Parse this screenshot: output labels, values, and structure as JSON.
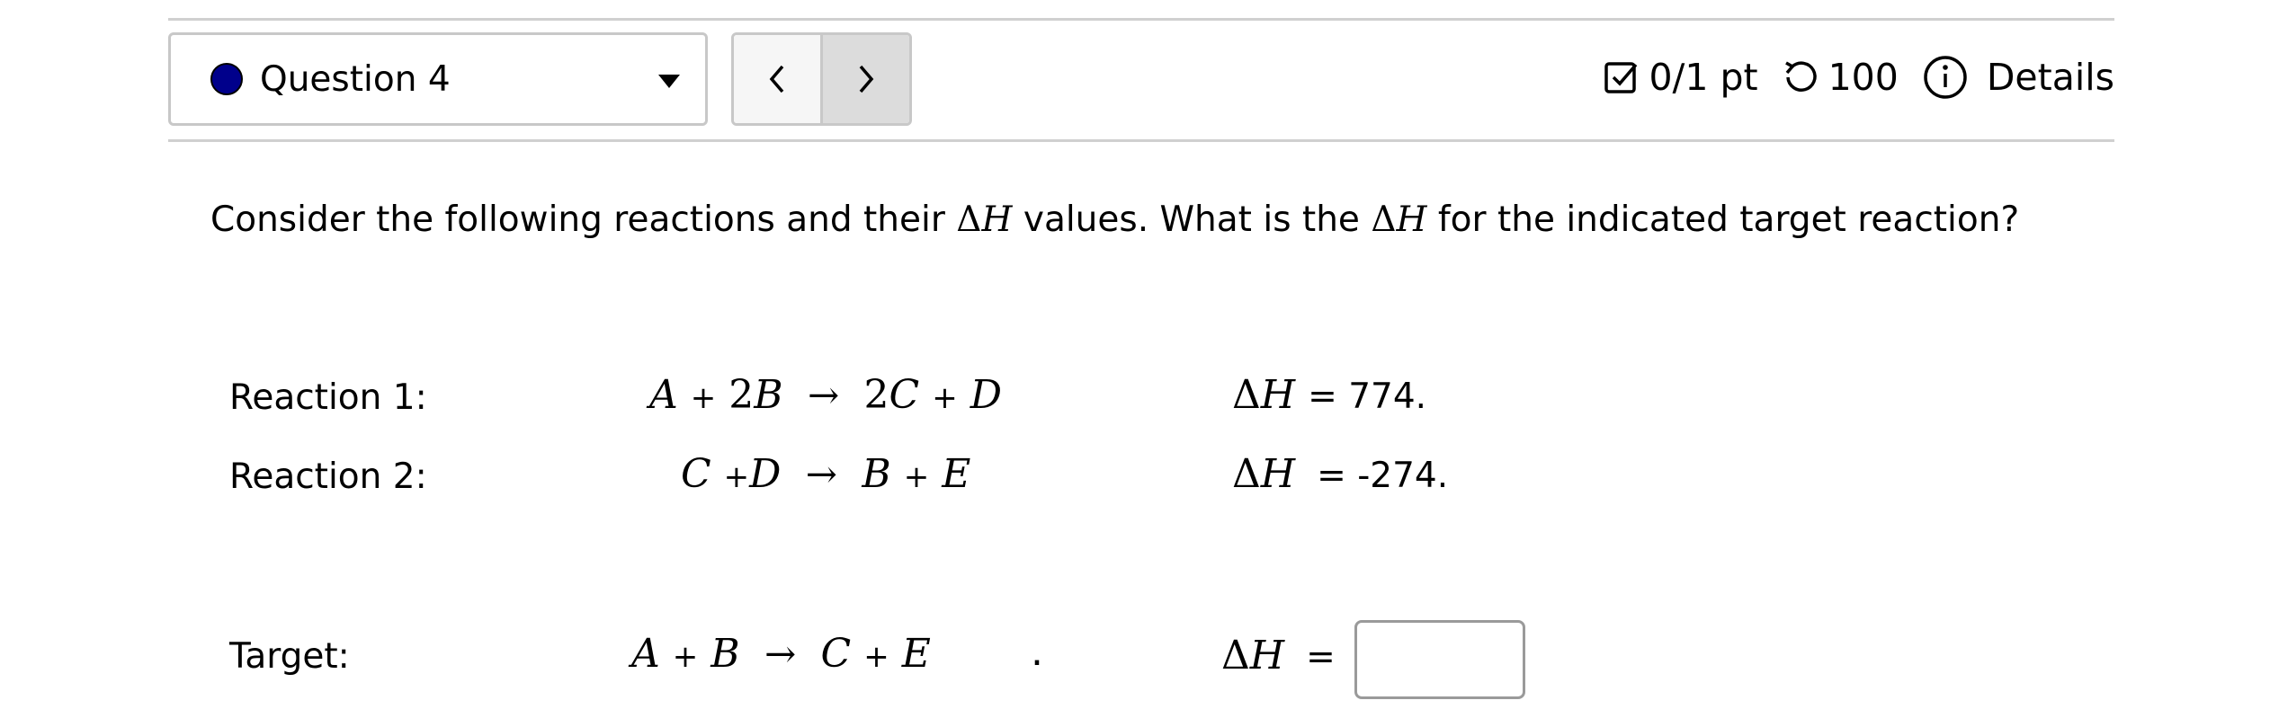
{
  "header": {
    "question_label": "Question 4",
    "status_color": "#00008b",
    "points": "0/1 pt",
    "attempts": "100",
    "details": "Details",
    "icons": {
      "points": "checkbox-icon",
      "attempts": "retry-icon",
      "details": "info-icon",
      "prev": "chevron-left-icon",
      "next": "chevron-right-icon",
      "dropdown": "caret-down-icon"
    }
  },
  "question": {
    "prefix": "Consider the following reactions and their",
    "middle": "values.  What is the",
    "suffix": "for the indicated target reaction?",
    "delta": "Δ",
    "h": "H"
  },
  "reactions": [
    {
      "label": "Reaction 1:",
      "equation": "A + 2B → 2C + D",
      "dh_symbol": "ΔH",
      "dh_value": "= 774."
    },
    {
      "label": "Reaction 2:",
      "equation": "C +D → B + E",
      "dh_symbol": "ΔH",
      "dh_value": "= -274."
    }
  ],
  "target": {
    "label": "Target:",
    "equation": "A + B → C + E",
    "trailing": ".",
    "dh_symbol": "ΔH",
    "dh_equals": "=",
    "answer_value": ""
  }
}
